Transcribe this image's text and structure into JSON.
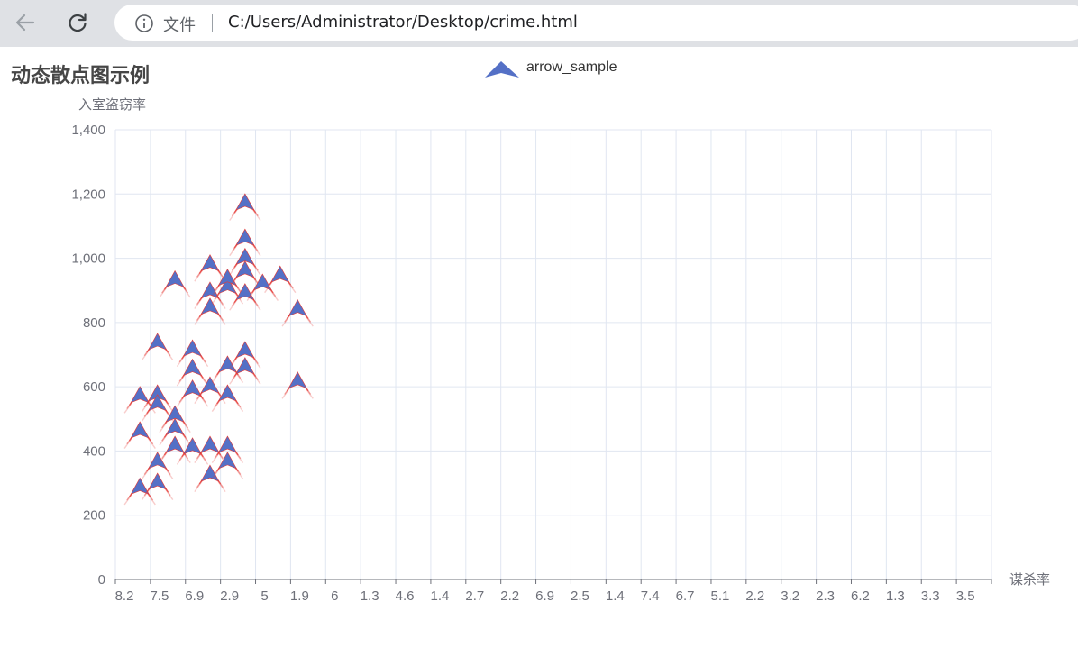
{
  "browser": {
    "address_label": "文件",
    "url": "C:/Users/Administrator/Desktop/crime.html"
  },
  "colors": {
    "marker": "#5470c6",
    "ripple": "#e53935",
    "grid": "#e0e6f1",
    "axis": "#6e7079"
  },
  "chart_data": {
    "type": "scatter",
    "title": "动态散点图示例",
    "legend": [
      "arrow_sample"
    ],
    "legend_placement": "top-center",
    "xlabel": "谋杀率",
    "ylabel": "入室盗窃率",
    "ylim": [
      0,
      1400
    ],
    "y_ticks": [
      "0",
      "200",
      "400",
      "600",
      "800",
      "1,000",
      "1,200",
      "1,400"
    ],
    "categories": [
      "8.2",
      "7.5",
      "6.9",
      "2.9",
      "5",
      "1.9",
      "6",
      "1.3",
      "4.6",
      "1.4",
      "2.7",
      "2.2",
      "6.9",
      "2.5",
      "1.4",
      "7.4",
      "6.7",
      "5.1",
      "2.2",
      "3.2",
      "2.3",
      "6.2",
      "1.3",
      "3.3",
      "3.5"
    ],
    "grid": true,
    "symbol": "arrow",
    "effect": "ripple",
    "series": [
      {
        "name": "arrow_sample",
        "points": [
          [
            0.7,
            285
          ],
          [
            1.2,
            300
          ],
          [
            0.7,
            460
          ],
          [
            1.2,
            365
          ],
          [
            0.7,
            570
          ],
          [
            1.2,
            575
          ],
          [
            1.2,
            545
          ],
          [
            1.7,
            510
          ],
          [
            1.7,
            470
          ],
          [
            1.7,
            415
          ],
          [
            1.2,
            735
          ],
          [
            1.7,
            930
          ],
          [
            2.2,
            410
          ],
          [
            2.2,
            590
          ],
          [
            2.2,
            655
          ],
          [
            2.2,
            715
          ],
          [
            2.7,
            325
          ],
          [
            2.7,
            415
          ],
          [
            2.7,
            600
          ],
          [
            2.7,
            845
          ],
          [
            2.7,
            895
          ],
          [
            2.7,
            980
          ],
          [
            3.2,
            365
          ],
          [
            3.2,
            415
          ],
          [
            3.2,
            575
          ],
          [
            3.2,
            665
          ],
          [
            3.2,
            910
          ],
          [
            3.2,
            935
          ],
          [
            3.7,
            660
          ],
          [
            3.7,
            710
          ],
          [
            3.7,
            890
          ],
          [
            3.7,
            960
          ],
          [
            3.7,
            1000
          ],
          [
            3.7,
            1060
          ],
          [
            3.7,
            1170
          ],
          [
            4.2,
            920
          ],
          [
            4.7,
            945
          ],
          [
            5.2,
            840
          ],
          [
            5.2,
            615
          ]
        ]
      }
    ]
  }
}
